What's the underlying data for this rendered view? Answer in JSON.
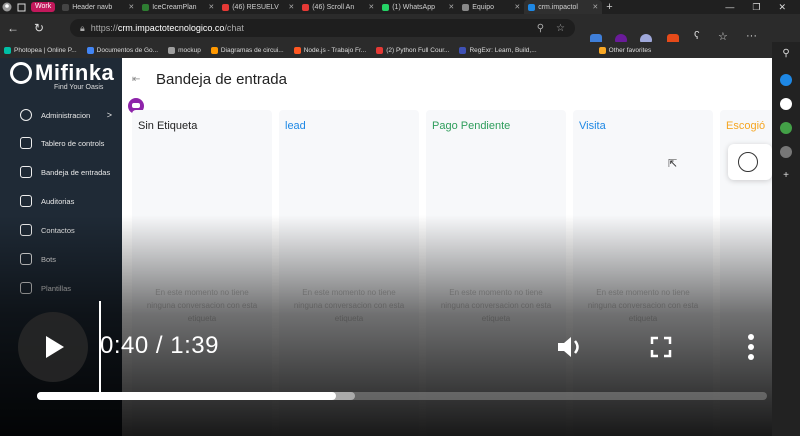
{
  "browser": {
    "tabs": [
      {
        "label": "Header navb",
        "color": "#444"
      },
      {
        "label": "IceCreamPlan",
        "color": "#2e7d32"
      },
      {
        "label": "(46) RESUELV",
        "color": "#e53935"
      },
      {
        "label": "(46) Scroll An",
        "color": "#e53935"
      },
      {
        "label": "(1) WhatsApp",
        "color": "#25d366"
      },
      {
        "label": "Equipo",
        "color": "#888"
      },
      {
        "label": "crm.impactol",
        "color": "#1e88e5"
      }
    ],
    "work_badge": "Work",
    "url_scheme": "https://",
    "url_host": "crm.impactotecnologico.co",
    "url_path": "/chat",
    "bookmarks": [
      {
        "label": "Photopea | Online P...",
        "color": "#00bfa5"
      },
      {
        "label": "Documentos de Go...",
        "color": "#4285f4"
      },
      {
        "label": "mockup",
        "color": "#9e9e9e"
      },
      {
        "label": "Diagramas de circui...",
        "color": "#ff9800"
      },
      {
        "label": "Node.js - Trabajo Fr...",
        "color": "#ff5722"
      },
      {
        "label": "(2) Python Full Cour...",
        "color": "#e53935"
      },
      {
        "label": "RegExr: Learn, Build,...",
        "color": "#3f51b5"
      },
      {
        "label": "Other favorites",
        "color": "#f9a825"
      }
    ]
  },
  "app": {
    "brand": "Mifinka",
    "tagline": "Find Your Oasis",
    "page_title": "Bandeja de entrada",
    "nav": [
      {
        "label": "Administracion",
        "has_chevron": true,
        "chevron": ">"
      },
      {
        "label": "Tablero de controls"
      },
      {
        "label": "Bandeja de entradas"
      },
      {
        "label": "Auditorias"
      },
      {
        "label": "Contactos"
      },
      {
        "label": "Bots"
      },
      {
        "label": "Plantillas"
      }
    ],
    "columns": [
      {
        "title": "Sin Etiqueta",
        "color": "#222222",
        "empty": "En este momento no tiene ninguna conversacion con esta etiqueta"
      },
      {
        "title": "lead",
        "color": "#1e88e5",
        "empty": "En este momento no tiene ninguna conversacion con esta etiqueta"
      },
      {
        "title": "Pago Pendiente",
        "color": "#2e9d5b",
        "empty": "En este momento no tiene ninguna conversacion con esta etiqueta"
      },
      {
        "title": "Visita",
        "color": "#1e88e5",
        "empty": "En este momento no tiene ninguna conversacion con esta etiqueta"
      },
      {
        "title": "Escogió",
        "color": "#f5a623",
        "empty": ""
      }
    ]
  },
  "video": {
    "time": "0:40 / 1:39",
    "played_fraction": 0.41,
    "buffered_fraction": 0.435
  }
}
